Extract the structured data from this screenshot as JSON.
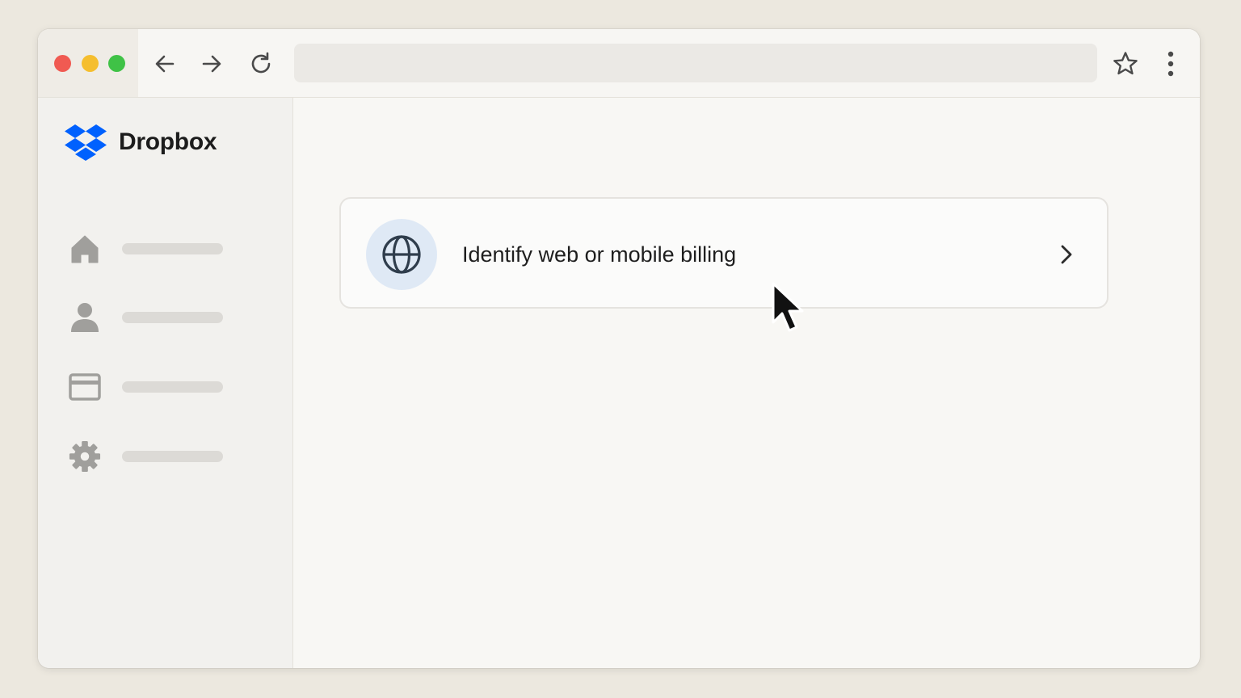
{
  "browser": {
    "traffic_lights": {
      "close_color": "#f05a52",
      "minimize_color": "#f5be2e",
      "maximize_color": "#3fc246"
    },
    "nav": {
      "back_icon": "arrow-left-icon",
      "forward_icon": "arrow-right-icon",
      "reload_icon": "reload-icon"
    },
    "address_bar": {
      "value": ""
    },
    "actions": {
      "bookmark_icon": "star-icon",
      "menu_icon": "kebab-menu-icon"
    }
  },
  "sidebar": {
    "brand": {
      "name": "Dropbox",
      "color": "#0061fe"
    },
    "items": [
      {
        "icon": "home-icon"
      },
      {
        "icon": "person-icon"
      },
      {
        "icon": "card-icon"
      },
      {
        "icon": "gear-icon"
      }
    ]
  },
  "main": {
    "option": {
      "label": "Identify web or mobile billing",
      "icon": "globe-icon",
      "trailing_icon": "chevron-right-icon"
    }
  }
}
